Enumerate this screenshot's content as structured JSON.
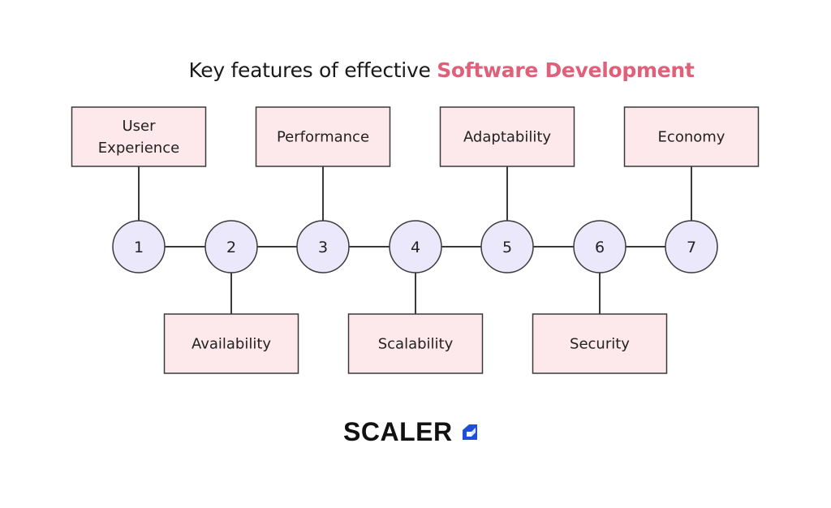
{
  "title": {
    "prefix": "Key features of effective",
    "highlight": "Software Development",
    "highlight_color": "#e0607a"
  },
  "colors": {
    "box_fill": "#fde8ec",
    "circle_fill": "#ece8fb",
    "stroke": "#3a3a3a",
    "logo_accent": "#1f4fd6"
  },
  "features": [
    {
      "number": "1",
      "label": [
        "User",
        "Experience"
      ],
      "position": "top"
    },
    {
      "number": "2",
      "label": [
        "Availability"
      ],
      "position": "bottom"
    },
    {
      "number": "3",
      "label": [
        "Performance"
      ],
      "position": "top"
    },
    {
      "number": "4",
      "label": [
        "Scalability"
      ],
      "position": "bottom"
    },
    {
      "number": "5",
      "label": [
        "Adaptability"
      ],
      "position": "top"
    },
    {
      "number": "6",
      "label": [
        "Security"
      ],
      "position": "bottom"
    },
    {
      "number": "7",
      "label": [
        "Economy"
      ],
      "position": "top"
    }
  ],
  "logo": {
    "text": "SCALER",
    "icon": "scaler-cube-icon"
  }
}
